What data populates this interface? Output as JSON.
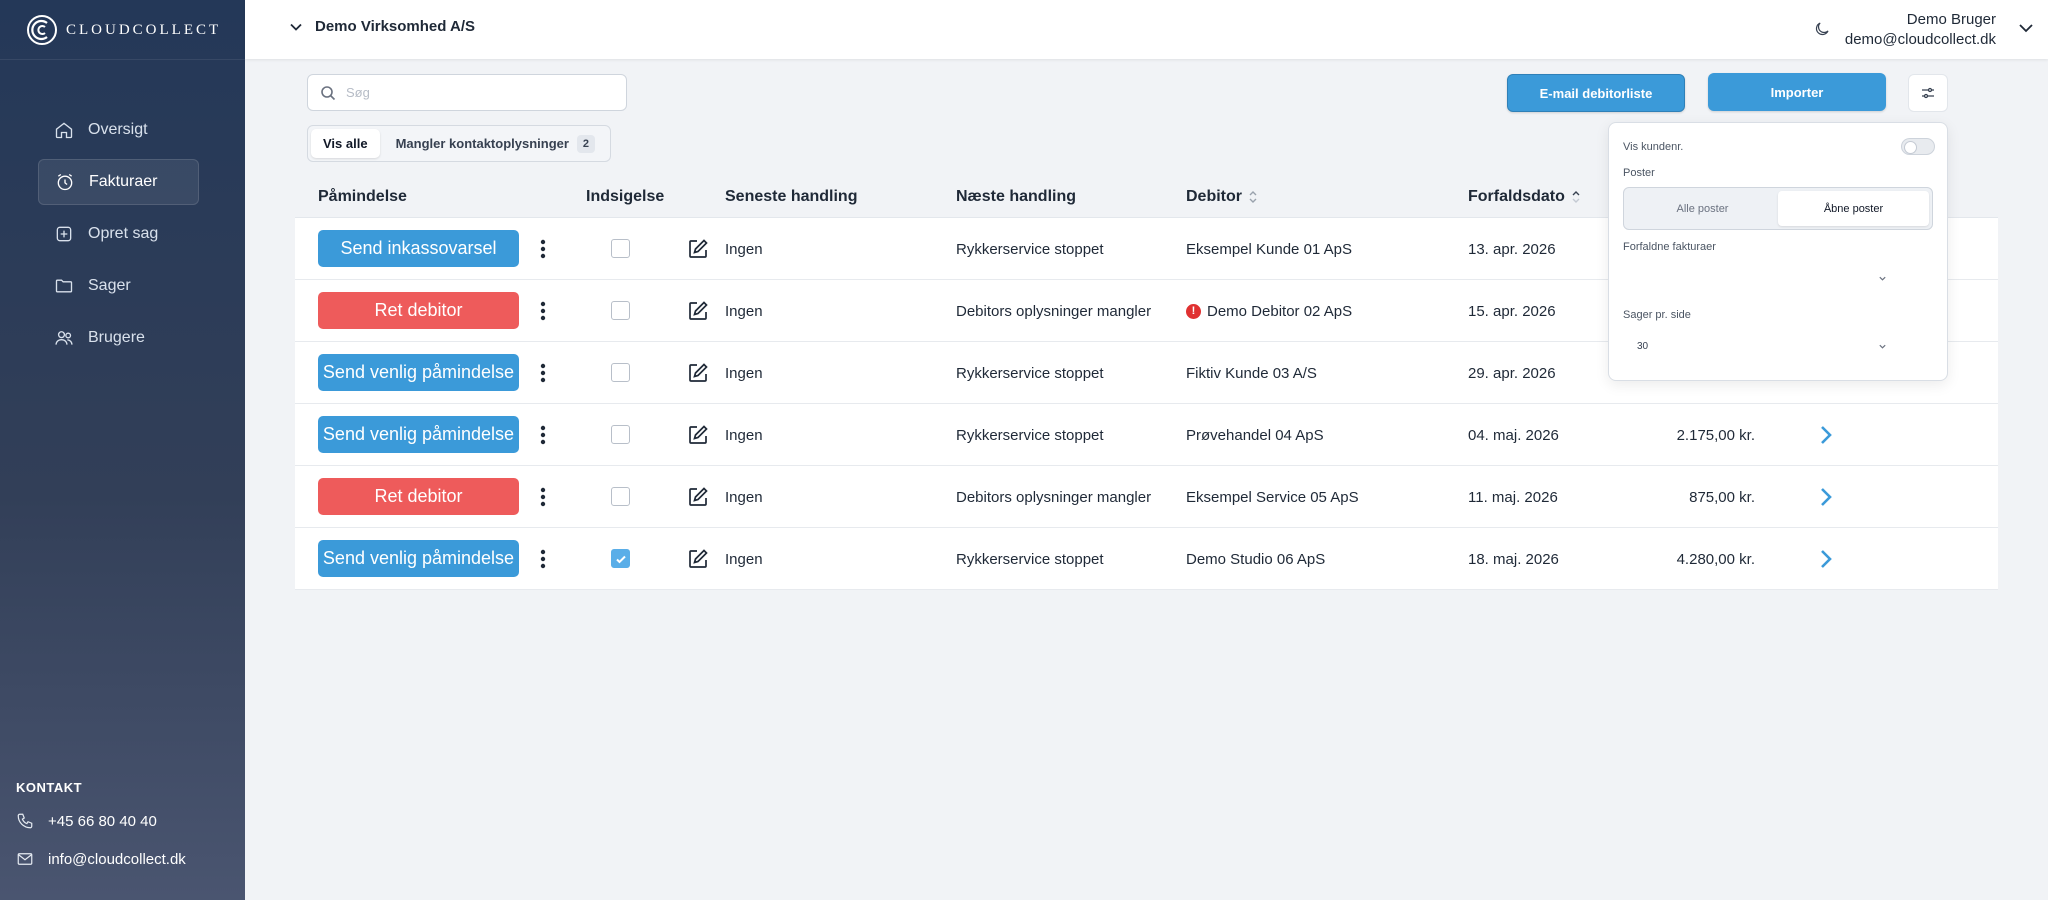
{
  "brand": {
    "name": "CLOUDCOLLECT"
  },
  "sidebar": {
    "items": [
      {
        "label": "Oversigt",
        "icon": "home-icon"
      },
      {
        "label": "Fakturaer",
        "icon": "alarm-clock-icon"
      },
      {
        "label": "Opret sag",
        "icon": "plus-square-icon"
      },
      {
        "label": "Sager",
        "icon": "folder-icon"
      },
      {
        "label": "Brugere",
        "icon": "users-icon"
      }
    ],
    "active_index": 1,
    "contact": {
      "title": "KONTAKT",
      "phone": "+45 66 80 40 40",
      "email": "info@cloudcollect.dk"
    }
  },
  "header": {
    "company": "Demo Virksomhed A/S",
    "user_name": "Demo Bruger",
    "user_email": "demo@cloudcollect.dk"
  },
  "toolbar": {
    "search_placeholder": "Søg",
    "email_button": "E-mail debitorliste",
    "import_button": "Importer"
  },
  "filters": {
    "show_all": "Vis alle",
    "missing_contact": "Mangler kontaktoplysninger",
    "missing_count": "2"
  },
  "table": {
    "columns": {
      "reminder": "Påmindelse",
      "notice": "Indsigelse",
      "last_action": "Seneste handling",
      "next_action": "Næste handling",
      "debtor": "Debitor",
      "due_date": "Forfaldsdato"
    },
    "rows": [
      {
        "action": "Send inkassovarsel",
        "action_color": "#3b9ad9",
        "checked": false,
        "last": "Ingen",
        "next": "Rykkerservice stoppet",
        "debtor": "Eksempel Kunde 01 ApS",
        "warning": false,
        "due": "13. apr. 2026",
        "amount": ""
      },
      {
        "action": "Ret debitor",
        "action_color": "#ee5b5b",
        "checked": false,
        "last": "Ingen",
        "next": "Debitors oplysninger mangler",
        "debtor": "Demo Debitor 02 ApS",
        "warning": true,
        "due": "15. apr. 2026",
        "amount": ""
      },
      {
        "action": "Send venlig påmindelse",
        "action_color": "#3b9ad9",
        "checked": false,
        "last": "Ingen",
        "next": "Rykkerservice stoppet",
        "debtor": "Fiktiv Kunde 03 A/S",
        "warning": false,
        "due": "29. apr. 2026",
        "amount": ""
      },
      {
        "action": "Send venlig påmindelse",
        "action_color": "#3b9ad9",
        "checked": false,
        "last": "Ingen",
        "next": "Rykkerservice stoppet",
        "debtor": "Prøvehandel 04 ApS",
        "warning": false,
        "due": "04. maj. 2026",
        "amount": "2.175,00 kr."
      },
      {
        "action": "Ret debitor",
        "action_color": "#ee5b5b",
        "checked": false,
        "last": "Ingen",
        "next": "Debitors oplysninger mangler",
        "debtor": "Eksempel Service 05 ApS",
        "warning": false,
        "due": "11. maj. 2026",
        "amount": "875,00 kr."
      },
      {
        "action": "Send venlig påmindelse",
        "action_color": "#3b9ad9",
        "checked": true,
        "last": "Ingen",
        "next": "Rykkerservice stoppet",
        "debtor": "Demo Studio 06 ApS",
        "warning": false,
        "due": "18. maj. 2026",
        "amount": "4.280,00 kr."
      }
    ]
  },
  "popover": {
    "show_customer_no": "Vis kundenr.",
    "entries_label": "Poster",
    "all_entries": "Alle poster",
    "open_entries": "Åbne poster",
    "overdue_label": "Forfaldne fakturaer",
    "overdue_value": "",
    "per_page_label": "Sager pr. side",
    "per_page_value": "30"
  }
}
